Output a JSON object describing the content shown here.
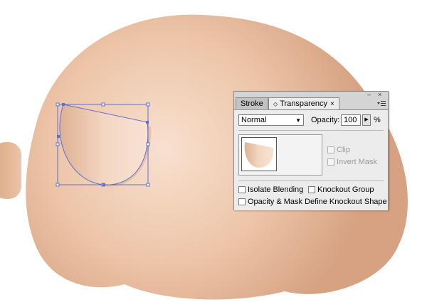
{
  "panel": {
    "tabs": [
      {
        "label": "Stroke",
        "active": false
      },
      {
        "label": "Transparency",
        "active": true
      }
    ],
    "blend_mode": "Normal",
    "opacity_label": "Opacity:",
    "opacity_value": "100",
    "percent": "%",
    "clip_label": "Clip",
    "invert_mask_label": "Invert Mask",
    "isolate_blending_label": "Isolate Blending",
    "knockout_group_label": "Knockout Group",
    "opacity_mask_label": "Opacity & Mask Define Knockout Shape"
  },
  "colors": {
    "skin_light": "#f7ddc9",
    "skin_dark": "#d9a886",
    "selection": "#5b6fd6"
  },
  "icons": [
    "minimize-icon",
    "close-icon",
    "panel-menu-icon",
    "chevron-down-icon",
    "stepper-arrow-icon",
    "tab-close-icon",
    "tab-collapse-icon"
  ]
}
